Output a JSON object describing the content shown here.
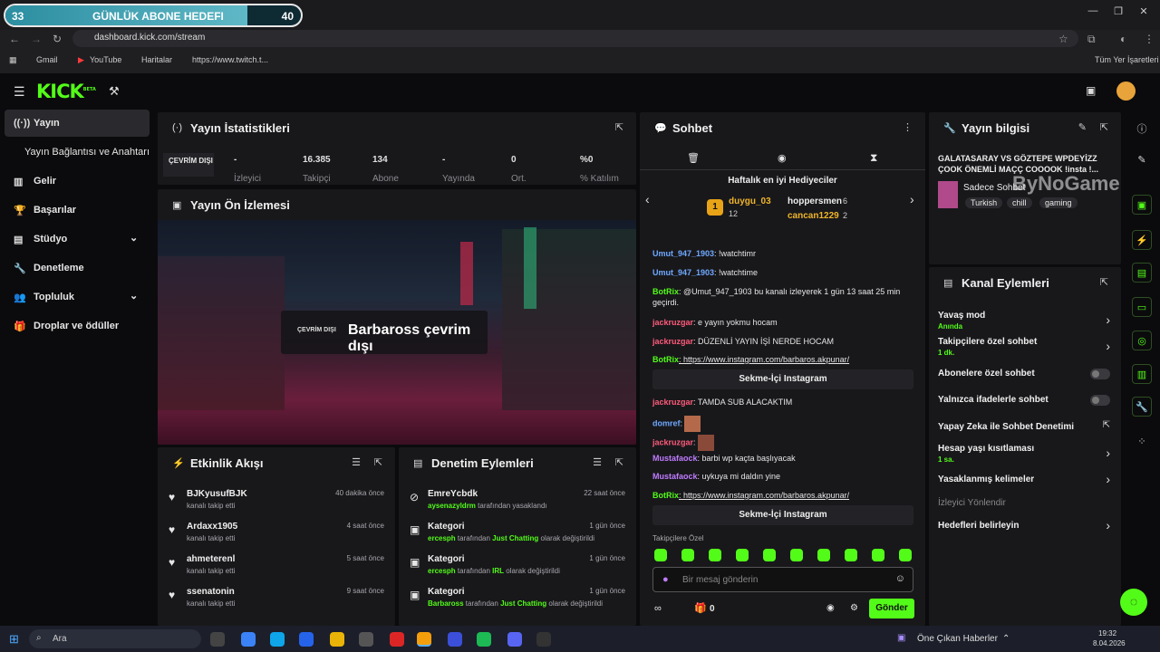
{
  "goal": {
    "start": "33",
    "title": "GÜNLÜK ABONE HEDEFI",
    "end": "40",
    "progress": 0.82
  },
  "browser": {
    "url": "dashboard.kick.com/stream",
    "bookmarks": [
      "Gmail",
      "YouTube",
      "Haritalar",
      "https://www.twitch.t...",
      "Tüm Yer İşaretleri"
    ]
  },
  "sidebar": {
    "items": [
      {
        "label": "Yayın",
        "icon": "broadcast-icon"
      },
      {
        "label": "Yayın Bağlantısı ve Anahtarı",
        "icon": ""
      },
      {
        "label": "Gelir",
        "icon": "chart-icon"
      },
      {
        "label": "Başarılar",
        "icon": "trophy-icon"
      },
      {
        "label": "Stüdyo",
        "icon": "studio-icon"
      },
      {
        "label": "Denetleme",
        "icon": "wrench-icon"
      },
      {
        "label": "Topluluk",
        "icon": "people-icon"
      },
      {
        "label": "Droplar ve ödüller",
        "icon": "gift-icon"
      }
    ]
  },
  "stats": {
    "title": "Yayın İstatistikleri",
    "status": "ÇEVRİM DIŞI",
    "values": [
      "-",
      "16.385",
      "134",
      "-",
      "0",
      "%0"
    ],
    "labels": [
      "İzleyici",
      "Takipçi",
      "Abone",
      "Yayında",
      "Ort.",
      "% Katılım"
    ]
  },
  "preview": {
    "title": "Yayın Ön İzlemesi",
    "badge": "ÇEVRİM DIŞI",
    "text": "Barbaross çevrim dışı"
  },
  "activity": {
    "title": "Etkinlik Akışı",
    "rows": [
      {
        "name": "BJKyusufBJK",
        "sub": "kanalı takip etti",
        "time": "40 dakika önce"
      },
      {
        "name": "Ardaxx1905",
        "sub": "kanalı takip etti",
        "time": "4 saat önce"
      },
      {
        "name": "ahmeterenl",
        "sub": "kanalı takip etti",
        "time": "5 saat önce"
      },
      {
        "name": "ssenatonin",
        "sub": "kanalı takip etti",
        "time": "9 saat önce"
      }
    ]
  },
  "moderation": {
    "title": "Denetim Eylemleri",
    "rows": [
      {
        "name": "EmreYcbdk",
        "user": "aysenazyldrm",
        "mid": " tarafından yasaklandı",
        "cat": "",
        "tail": "",
        "time": "22 saat önce"
      },
      {
        "name": "Kategori",
        "user": "ercesph",
        "mid": " tarafından ",
        "cat": "Just Chatting",
        "tail": " olarak değiştirildi",
        "time": "1 gün önce"
      },
      {
        "name": "Kategori",
        "user": "ercesph",
        "mid": " tarafından ",
        "cat": "IRL",
        "tail": " olarak değiştirildi",
        "time": "1 gün önce"
      },
      {
        "name": "Kategori",
        "user": "Barbaross",
        "mid": " tarafından ",
        "cat": "Just Chatting",
        "tail": " olarak değiştirildi",
        "time": "1 gün önce"
      }
    ]
  },
  "chat": {
    "title": "Sohbet",
    "gifters_title": "Haftalık en iyi Hediyeciler",
    "g1": "duygu_03",
    "g1n": "12",
    "g2": "hoppersmen",
    "g2n": "6",
    "g3": "cancan1229",
    "g3n": "2",
    "messages": [
      {
        "user": "Umut_947_1903",
        "color": "#6fa8ff",
        "text": ": !watchtimr"
      },
      {
        "user": "Umut_947_1903",
        "color": "#6fa8ff",
        "text": ": !watchtime"
      },
      {
        "user": "BotRix",
        "color": "#53fc18",
        "text": ": @Umut_947_1903 bu kanalı izleyerek 1 gün 13 saat 25 min geçirdi."
      },
      {
        "user": "jackruzgar",
        "color": "#ff5a7a",
        "text": ": e yayın yokmu hocam"
      },
      {
        "user": "jackruzgar",
        "color": "#ff5a7a",
        "text": ": DÜZENLİ YAYIN İŞİ NERDE HOCAM"
      },
      {
        "user": "BotRix",
        "color": "#53fc18",
        "text": ": https://www.instagram.com/barbaros.akpunar/"
      },
      {
        "user": "jackruzgar",
        "color": "#ff5a7a",
        "text": ": TAMDA SUB ALACAKTIM"
      },
      {
        "user": "domref",
        "color": "#6fa8ff",
        "text": ":"
      },
      {
        "user": "jackruzgar",
        "color": "#ff5a7a",
        "text": ":"
      },
      {
        "user": "Mustafaock",
        "color": "#c07cff",
        "text": ": barbi wp kaçta başlıyacak"
      },
      {
        "user": "Mustafaock",
        "color": "#c07cff",
        "text": ": uykuya mi daldın yine"
      },
      {
        "user": "BotRix",
        "color": "#53fc18",
        "text": ": https://www.instagram.com/barbaros.akpunar/"
      }
    ],
    "insta_btn": "Sekme-İçi Instagram",
    "followers_only": "Takipçilere Özel",
    "placeholder": "Bir mesaj gönderin",
    "points": "0",
    "send": "Gönder"
  },
  "info": {
    "title": "Yayın bilgisi",
    "stream_title": "GALATASARAY VS GÖZTEPE WPDEYİZZ ÇOOK ÖNEMLİ MAÇÇ COOOOK !insta !...",
    "category": "Sadece Sohbet",
    "tags": [
      "Turkish",
      "chill",
      "gaming"
    ],
    "watermark": "ByNoGame"
  },
  "actions": {
    "title": "Kanal Eylemleri",
    "items": [
      {
        "label": "Yavaş mod",
        "sub": "Anında",
        "kind": "chev"
      },
      {
        "label": "Takipçilere özel sohbet",
        "sub": "1 dk.",
        "kind": "chev"
      },
      {
        "label": "Abonelere özel sohbet",
        "sub": "",
        "kind": "tog"
      },
      {
        "label": "Yalnızca ifadelerle sohbet",
        "sub": "",
        "kind": "tog"
      },
      {
        "label": "Yapay Zeka ile Sohbet Denetimi",
        "sub": "",
        "kind": "ext"
      },
      {
        "label": "Hesap yaşı kısıtlaması",
        "sub": "1 sa.",
        "kind": "chev"
      },
      {
        "label": "Yasaklanmış kelimeler",
        "sub": "",
        "kind": "chev"
      },
      {
        "label": "İzleyici Yönlendir",
        "sub": "",
        "kind": "none"
      },
      {
        "label": "Hedefleri belirleyin",
        "sub": "",
        "kind": "chev"
      }
    ]
  },
  "taskbar": {
    "search": "Ara",
    "news": "Öne Çıkan Haberler",
    "time": "19:32",
    "date": "8.04.2026"
  },
  "colors": {
    "accent": "#53fc18",
    "panel": "#18181b",
    "bg": "#0b0b0d"
  }
}
